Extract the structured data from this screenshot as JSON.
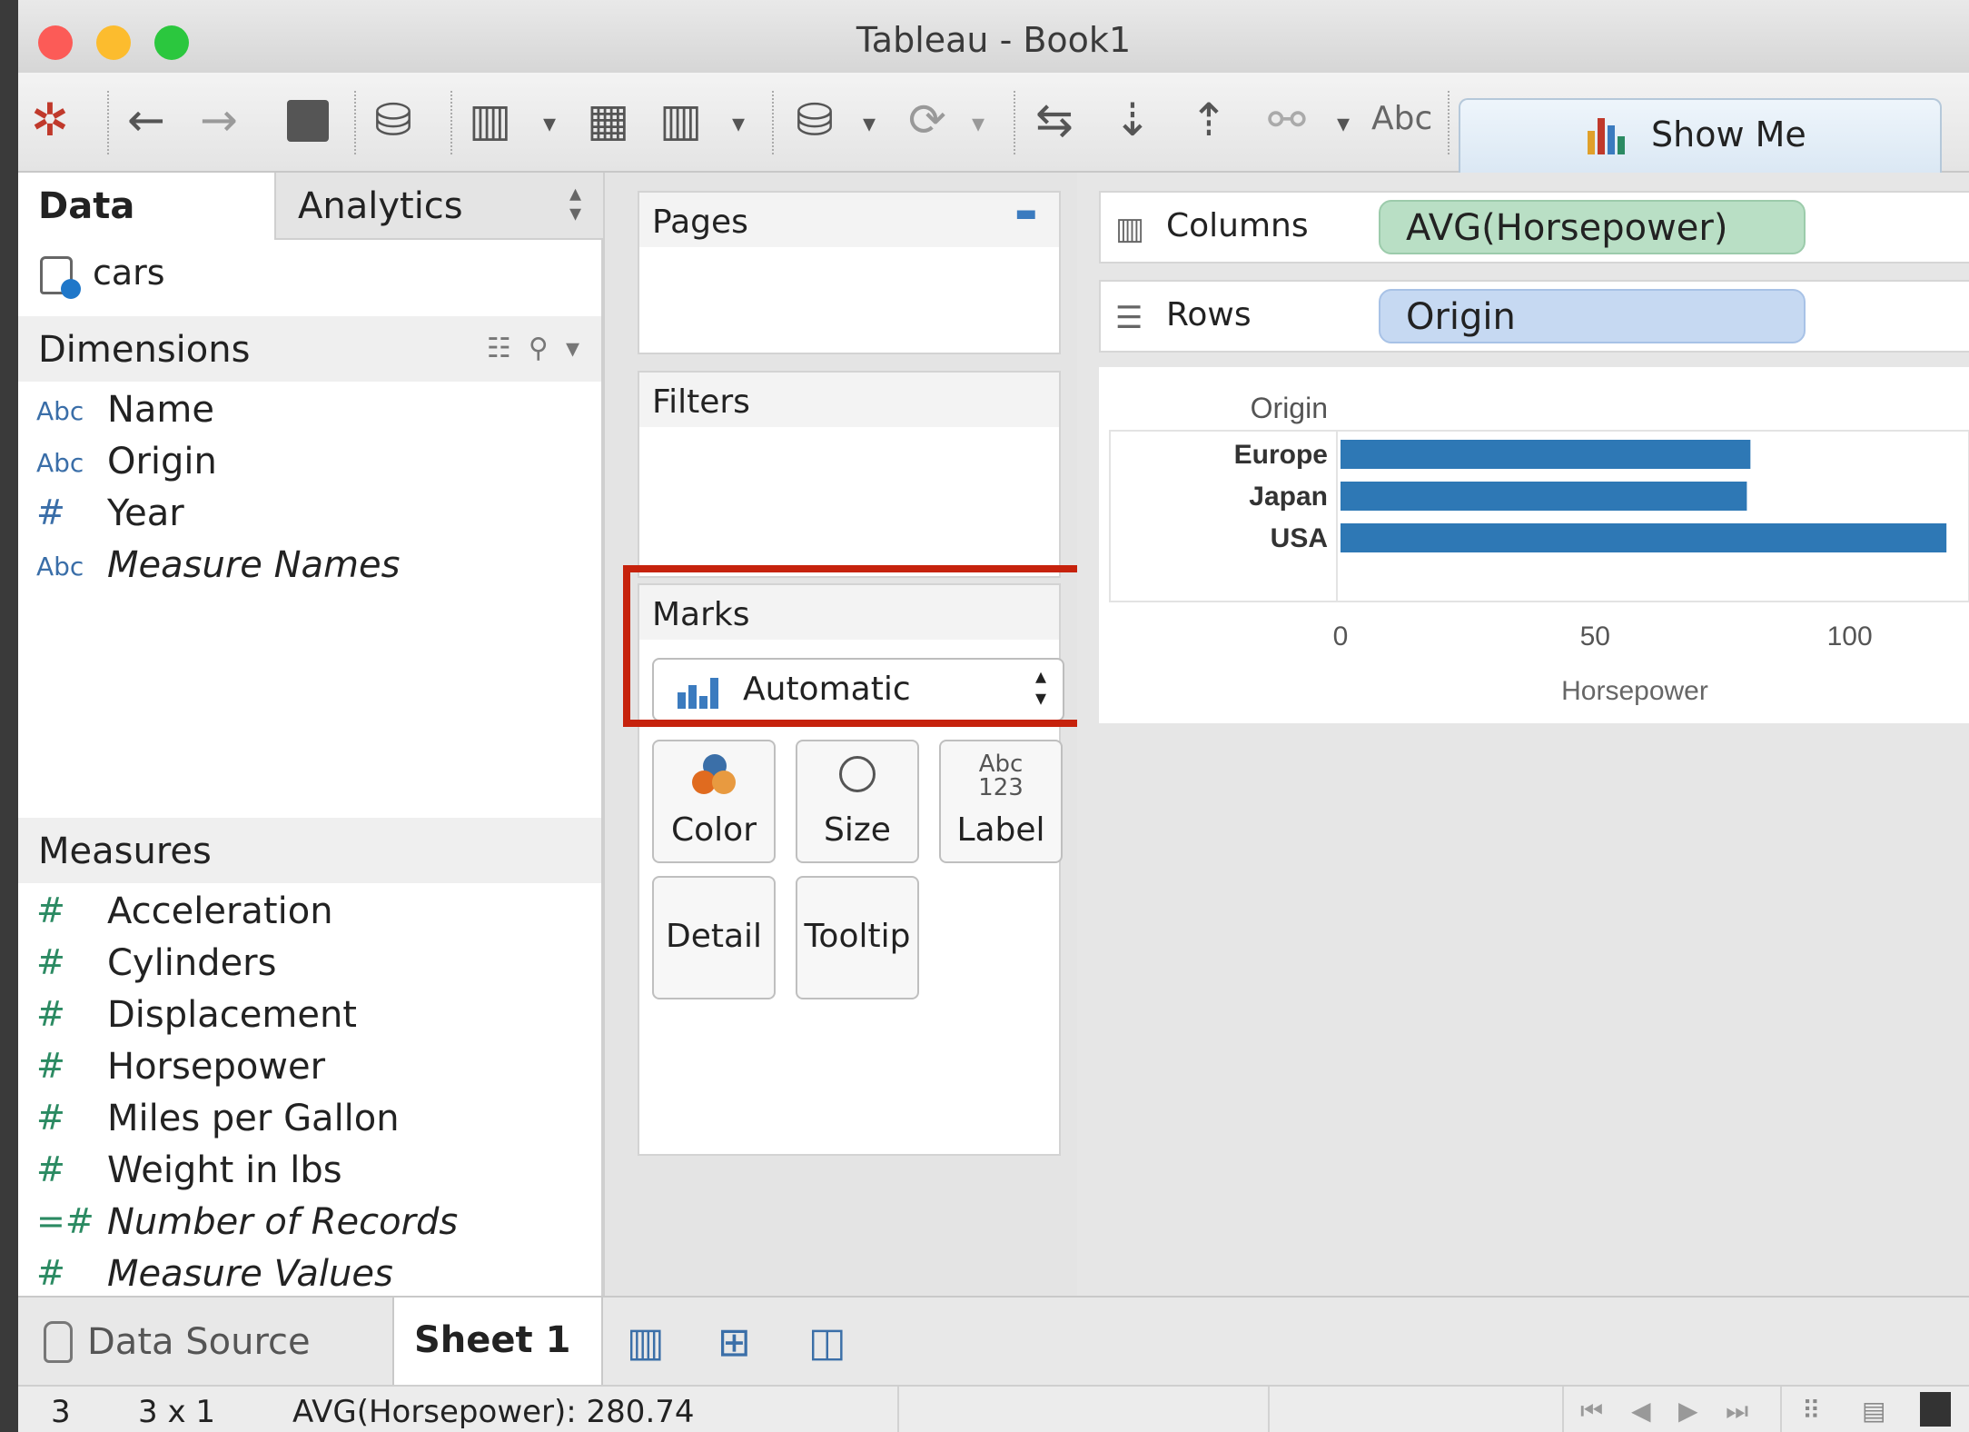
{
  "window": {
    "title": "Tableau - Book1"
  },
  "toolbar": {
    "abc_label": "Abc",
    "show_me_label": "Show Me"
  },
  "data_pane": {
    "tab_data": "Data",
    "tab_analytics": "Analytics",
    "source": "cars",
    "dimensions_header": "Dimensions",
    "dimensions": [
      {
        "type": "Abc",
        "name": "Name"
      },
      {
        "type": "Abc",
        "name": "Origin"
      },
      {
        "type": "#",
        "name": "Year"
      },
      {
        "type": "Abc",
        "name": "Measure Names"
      }
    ],
    "measures_header": "Measures",
    "measures": [
      {
        "type": "#",
        "name": "Acceleration"
      },
      {
        "type": "#",
        "name": "Cylinders"
      },
      {
        "type": "#",
        "name": "Displacement"
      },
      {
        "type": "#",
        "name": "Horsepower"
      },
      {
        "type": "#",
        "name": "Miles per Gallon"
      },
      {
        "type": "#",
        "name": "Weight in lbs"
      },
      {
        "type": "=#",
        "name": "Number of Records"
      },
      {
        "type": "#",
        "name": "Measure Values"
      }
    ]
  },
  "cards": {
    "pages": "Pages",
    "filters": "Filters",
    "marks": "Marks",
    "mark_type": "Automatic",
    "mark_buttons": {
      "color": "Color",
      "size": "Size",
      "label": "Label",
      "label_icon_top": "Abc",
      "label_icon_bottom": "123",
      "detail": "Detail",
      "tooltip": "Tooltip"
    }
  },
  "shelves": {
    "columns_label": "Columns",
    "columns_pill": "AVG(Horsepower)",
    "rows_label": "Rows",
    "rows_pill": "Origin"
  },
  "chart_data": {
    "type": "bar",
    "orientation": "horizontal",
    "row_header": "Origin",
    "categories": [
      "Europe",
      "Japan",
      "USA"
    ],
    "values": [
      80.5,
      79.8,
      119.0
    ],
    "xlabel": "Horsepower",
    "xticks": [
      0,
      50,
      100
    ],
    "xlim": [
      0,
      122
    ],
    "bar_color": "#2e78b5"
  },
  "bottom": {
    "data_source": "Data Source",
    "sheet": "Sheet 1"
  },
  "status": {
    "marks": "3",
    "dims": "3 x 1",
    "summary": "AVG(Horsepower): 280.74"
  },
  "colors": {
    "highlight": "#c6220c",
    "pill_green": "#b9dfc5",
    "pill_blue": "#c6d9f2"
  }
}
